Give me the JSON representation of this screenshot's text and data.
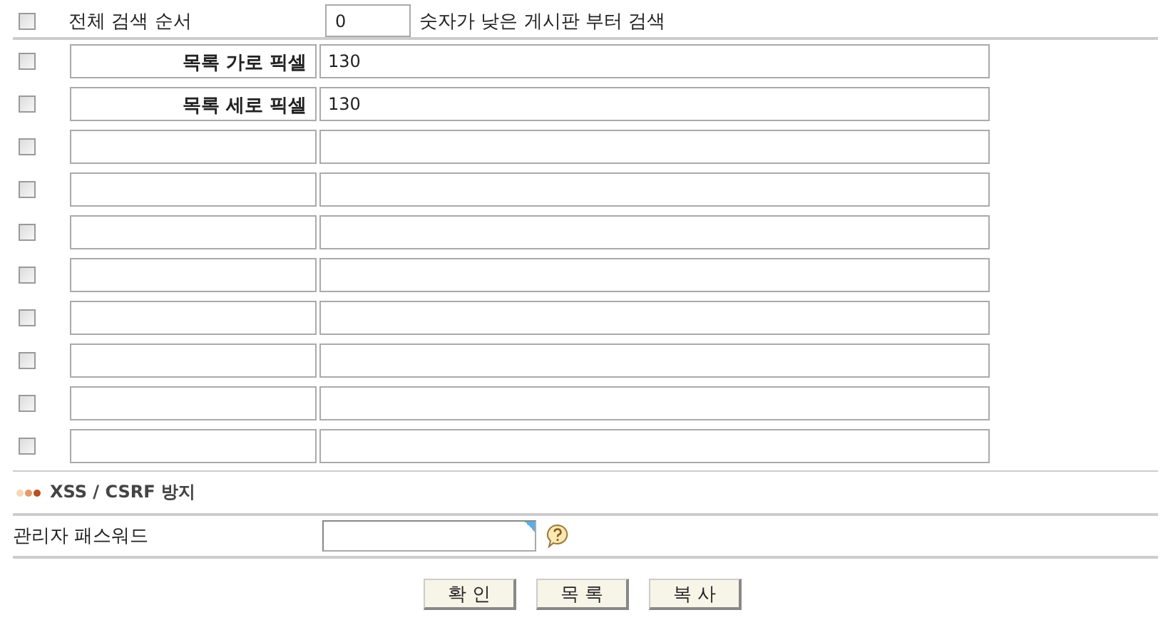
{
  "search_order": {
    "checked": false,
    "label": "전체 검색 순서",
    "value": "0",
    "hint": "숫자가 낮은 게시판 부터 검색"
  },
  "rows": [
    {
      "checked": false,
      "label": "목록 가로 픽셀",
      "value": "130"
    },
    {
      "checked": false,
      "label": "목록 세로 픽셀",
      "value": "130"
    },
    {
      "checked": false
    },
    {
      "checked": false
    },
    {
      "checked": false
    },
    {
      "checked": false
    },
    {
      "checked": false
    },
    {
      "checked": false
    },
    {
      "checked": false
    },
    {
      "checked": false
    }
  ],
  "section_title": "XSS / CSRF 방지",
  "password": {
    "label": "관리자 패스워드"
  },
  "buttons": [
    "확 인",
    "목 록",
    "복 사"
  ]
}
